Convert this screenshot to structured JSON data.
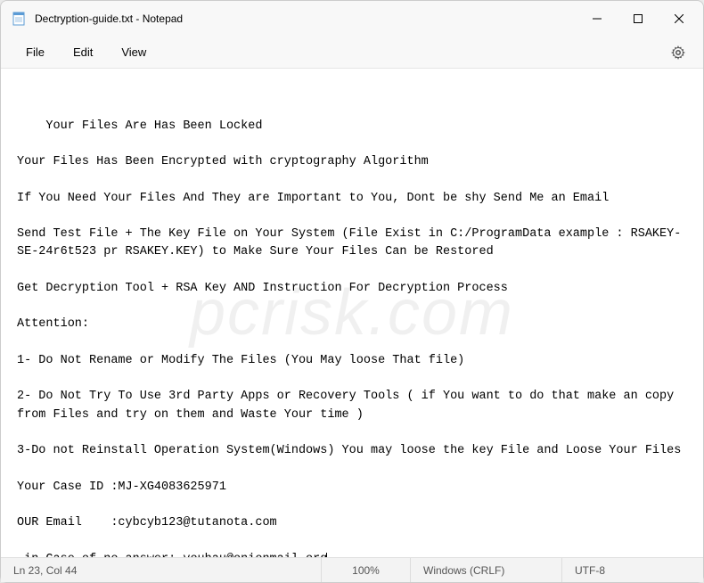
{
  "window": {
    "title": "Dectryption-guide.txt - Notepad"
  },
  "menu": {
    "file": "File",
    "edit": "Edit",
    "view": "View"
  },
  "content": {
    "lines": [
      "Your Files Are Has Been Locked",
      "",
      "Your Files Has Been Encrypted with cryptography Algorithm",
      "",
      "If You Need Your Files And They are Important to You, Dont be shy Send Me an Email",
      "",
      "Send Test File + The Key File on Your System (File Exist in C:/ProgramData example : RSAKEY-SE-24r6t523 pr RSAKEY.KEY) to Make Sure Your Files Can be Restored",
      "",
      "Get Decryption Tool + RSA Key AND Instruction For Decryption Process",
      "",
      "Attention:",
      "",
      "1- Do Not Rename or Modify The Files (You May loose That file)",
      "",
      "2- Do Not Try To Use 3rd Party Apps or Recovery Tools ( if You want to do that make an copy from Files and try on them and Waste Your time )",
      "",
      "3-Do not Reinstall Operation System(Windows) You may loose the key File and Loose Your Files",
      "",
      "Your Case ID :MJ-XG4083625971",
      "",
      "OUR Email    :cybcyb123@tutanota.com",
      "",
      " in Case of no answer: youhau@onionmail.org"
    ]
  },
  "status": {
    "position": "Ln 23, Col 44",
    "zoom": "100%",
    "encoding_mode": "Windows (CRLF)",
    "utf": "UTF-8"
  },
  "watermark": "pcrisk.com"
}
